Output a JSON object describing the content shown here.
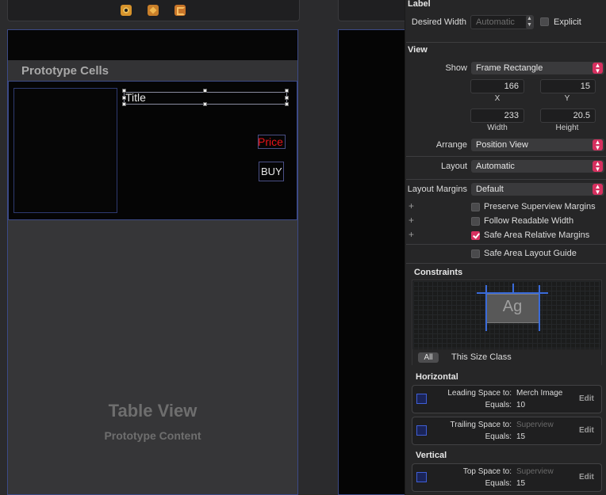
{
  "canvas": {
    "prototype_cells_label": "Prototype Cells",
    "cell": {
      "title_label": "Title",
      "price_label": "Price",
      "buy_button": "BUY"
    },
    "table_view_title": "Table View",
    "table_view_subtitle": "Prototype Content"
  },
  "inspector": {
    "label_section": {
      "title": "Label",
      "desired_width_label": "Desired Width",
      "desired_width_value": "Automatic",
      "explicit_label": "Explicit",
      "explicit_checked": false
    },
    "view_section": {
      "title": "View",
      "show_label": "Show",
      "show_value": "Frame Rectangle",
      "x_value": "166",
      "x_label": "X",
      "y_value": "15",
      "y_label": "Y",
      "width_value": "233",
      "width_label": "Width",
      "height_value": "20.5",
      "height_label": "Height",
      "arrange_label": "Arrange",
      "arrange_value": "Position View",
      "layout_label": "Layout",
      "layout_value": "Automatic",
      "layout_margins_label": "Layout Margins",
      "layout_margins_value": "Default",
      "options": [
        {
          "label": "Preserve Superview Margins",
          "checked": false
        },
        {
          "label": "Follow Readable Width",
          "checked": false
        },
        {
          "label": "Safe Area Relative Margins",
          "checked": true
        },
        {
          "label": "Safe Area Layout Guide",
          "checked": false
        }
      ]
    },
    "constraints": {
      "title": "Constraints",
      "preview_text": "Ag",
      "tab_all": "All",
      "tab_size_class": "This Size Class",
      "horizontal_title": "Horizontal",
      "vertical_title": "Vertical",
      "items": [
        {
          "key1": "Leading Space to:",
          "val1": "Merch Image",
          "key2": "Equals:",
          "val2": "10",
          "edit": "Edit"
        },
        {
          "key1": "Trailing Space to:",
          "val1": "Superview",
          "key2": "Equals:",
          "val2": "15",
          "edit": "Edit"
        },
        {
          "key1": "Top Space to:",
          "val1": "Superview",
          "key2": "Equals:",
          "val2": "15",
          "edit": "Edit"
        }
      ]
    }
  },
  "colors": {
    "accent": "#d6305f",
    "price_red": "#e8141a",
    "selection_blue": "#3c4a86"
  }
}
